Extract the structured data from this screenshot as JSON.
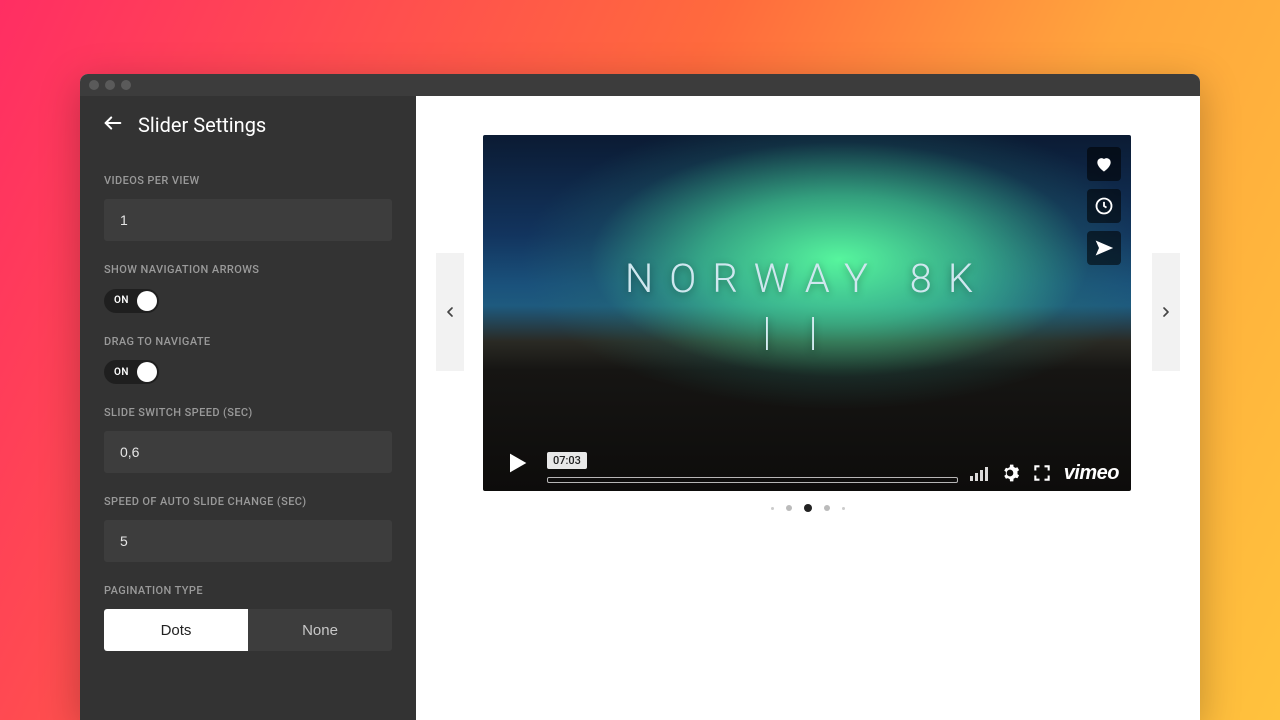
{
  "sidebar": {
    "title": "Slider Settings",
    "videos_per_view": {
      "label": "Videos per View",
      "value": "1"
    },
    "show_arrows": {
      "label": "Show Navigation Arrows",
      "state": "ON"
    },
    "drag_nav": {
      "label": "Drag to Navigate",
      "state": "ON"
    },
    "switch_speed": {
      "label": "Slide Switch Speed (sec)",
      "value": "0,6"
    },
    "auto_speed": {
      "label": "Speed of Auto Slide Change (sec)",
      "value": "5"
    },
    "pagination": {
      "label": "Pagination Type",
      "options": [
        "Dots",
        "None"
      ],
      "active": 0
    }
  },
  "preview": {
    "video_title_line1": "NORWAY 8K",
    "video_title_line2": "II",
    "duration": "07:03",
    "provider": "vimeo",
    "icons": {
      "like": "heart-icon",
      "watch_later": "clock-icon",
      "share": "send-icon",
      "play": "play-icon",
      "volume": "volume-bars-icon",
      "settings": "gear-icon",
      "fullscreen": "fullscreen-icon",
      "prev": "chevron-left-icon",
      "next": "chevron-right-icon"
    },
    "dots": {
      "count": 5,
      "active_index": 2
    }
  }
}
